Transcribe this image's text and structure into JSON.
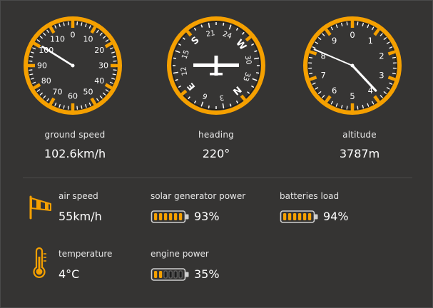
{
  "colors": {
    "accent": "#f5a000",
    "dial": "#363534",
    "panel": "#353433",
    "text": "#ffffff"
  },
  "gauges": {
    "ground_speed": {
      "label": "ground speed",
      "value": "102.6km/h",
      "dial_numbers": [
        "0",
        "10",
        "20",
        "30",
        "40",
        "50",
        "60",
        "70",
        "80",
        "90",
        "100",
        "110"
      ],
      "icon": "speedometer-dial"
    },
    "heading": {
      "label": "heading",
      "value": "220°",
      "dial_numbers": [
        "N",
        "3",
        "6",
        "E",
        "12",
        "15",
        "S",
        "21",
        "24",
        "W",
        "30",
        "33"
      ],
      "icon": "heading-compass-dial"
    },
    "altitude": {
      "label": "altitude",
      "value": "3787m",
      "dial_numbers": [
        "0",
        "1",
        "2",
        "3",
        "4",
        "5",
        "6",
        "7",
        "8",
        "9"
      ],
      "icon": "altimeter-dial"
    }
  },
  "stats": {
    "air_speed": {
      "label": "air speed",
      "value": "55km/h",
      "icon": "windsock-icon"
    },
    "temperature": {
      "label": "temperature",
      "value": "4°C",
      "icon": "thermometer-icon"
    },
    "solar_power": {
      "label": "solar generator power",
      "value": "93%",
      "level": 0.93,
      "icon": "battery-icon"
    },
    "engine_power": {
      "label": "engine power",
      "value": "35%",
      "level": 0.35,
      "icon": "battery-icon"
    },
    "batteries_load": {
      "label": "batteries load",
      "value": "94%",
      "level": 0.94,
      "icon": "battery-icon"
    }
  }
}
